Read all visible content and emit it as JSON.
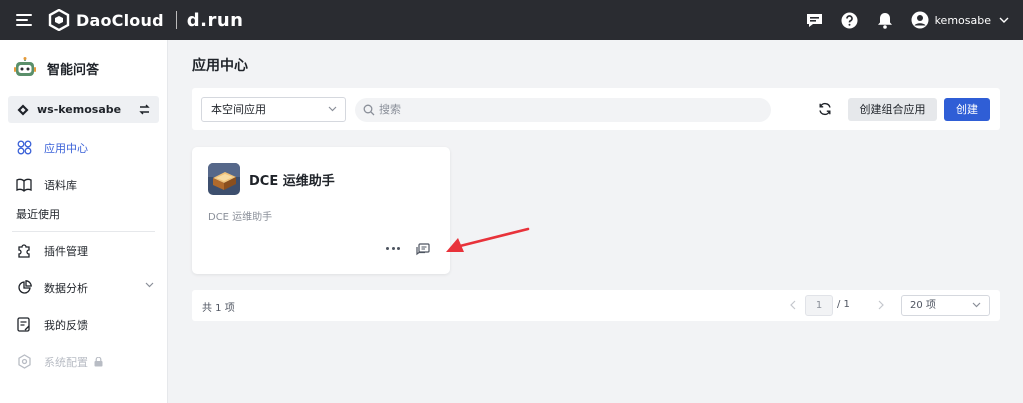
{
  "header": {
    "brand_name": "DaoCloud",
    "product_name": "d.run",
    "icons": [
      "menu-icon",
      "message-icon",
      "help-icon",
      "bell-icon",
      "user-avatar-icon"
    ],
    "username": "kemosabe"
  },
  "sidebar": {
    "title": "智能问答",
    "workspace": "ws-kemosabe",
    "items": [
      {
        "label": "应用中心",
        "icon": "apps-icon",
        "active": true
      },
      {
        "label": "语料库",
        "icon": "book-icon"
      }
    ],
    "recent_label": "最近使用",
    "recent_items": [
      {
        "label": "插件管理",
        "icon": "puzzle-icon"
      },
      {
        "label": "数据分析",
        "icon": "pie-chart-icon"
      },
      {
        "label": "我的反馈",
        "icon": "feedback-icon"
      },
      {
        "label": "系统配置",
        "icon": "settings-icon",
        "disabled": true
      }
    ]
  },
  "main": {
    "title": "应用中心",
    "filter_select": "本空间应用",
    "search_placeholder": "搜索",
    "btn_create_combo": "创建组合应用",
    "btn_create": "创建",
    "apps": [
      {
        "name": "DCE 运维助手",
        "description": "DCE 运维助手"
      }
    ],
    "pagination": {
      "total_text": "共 1 项",
      "current_page": "1",
      "total_pages_text": "/ 1",
      "page_size": "20 项"
    }
  },
  "colors": {
    "topbar": "#2a2c31",
    "accent": "#2f5ed6",
    "active_nav": "#3b62d8",
    "annotation_arrow": "#e8323a"
  }
}
